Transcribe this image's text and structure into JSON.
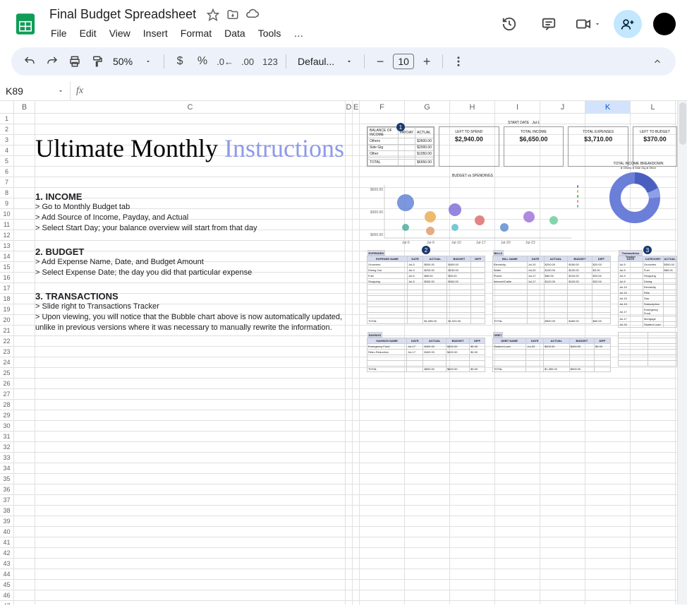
{
  "doc_title": "Final Budget Spreadsheet",
  "menus": [
    "File",
    "Edit",
    "View",
    "Insert",
    "Format",
    "Data",
    "Tools"
  ],
  "menu_overflow": "…",
  "toolbar": {
    "zoom": "50%",
    "num123": "123",
    "font": "Defaul...",
    "font_size": "10"
  },
  "namebox": "K89",
  "columns": [
    "B",
    "C",
    "D",
    "E",
    "F",
    "G",
    "H",
    "I",
    "J",
    "K",
    "L"
  ],
  "selected_col": "K",
  "title_black": "Ultimate Monthly ",
  "title_purple": "Instructions",
  "sections": {
    "income": {
      "h": "1. INCOME",
      "lines": [
        "> Go to Monthly Budget tab",
        "> Add Source of Income, Payday, and Actual",
        "> Select Start Day; your balance overview will start from that day"
      ]
    },
    "budget": {
      "h": "2. BUDGET",
      "lines": [
        "> Add Expense Name, Date, and Budget Amount",
        "> Select Expense Date; the day you did that particular expense"
      ]
    },
    "transactions": {
      "h": "3. TRANSACTIONS",
      "lines": [
        "> Slide right to Transactions Tracker",
        "> Upon viewing, you will notice that the Bubble chart above is now automatically updated,",
        "unlike in previous versions where it was necessary to manually rewrite the information."
      ]
    }
  },
  "preview": {
    "start_date_label": "START DATE",
    "start_date_val": "Jul-1",
    "kpis": [
      {
        "label": "LEFT TO SPEND",
        "value": "$2,940.00"
      },
      {
        "label": "TOTAL INCOME",
        "value": "$6,650.00"
      },
      {
        "label": "TOTAL EXPENSES",
        "value": "$3,710.00"
      },
      {
        "label": "LEFT TO BUDGET",
        "value": "$370.00"
      }
    ],
    "balance_header": "BALANCE OF INCOME",
    "bubble_title": "BUDGET vs SPENDINGS",
    "donut_title": "TOTAL INCOME BREAKDOWN",
    "donut_legend": "● Others  ● Side Gig  ● Other",
    "table_titles": [
      "EXPENSES",
      "BILLS",
      ""
    ],
    "lower_titles": [
      "SAVINGS",
      "DEBT"
    ]
  },
  "row_count": 47
}
